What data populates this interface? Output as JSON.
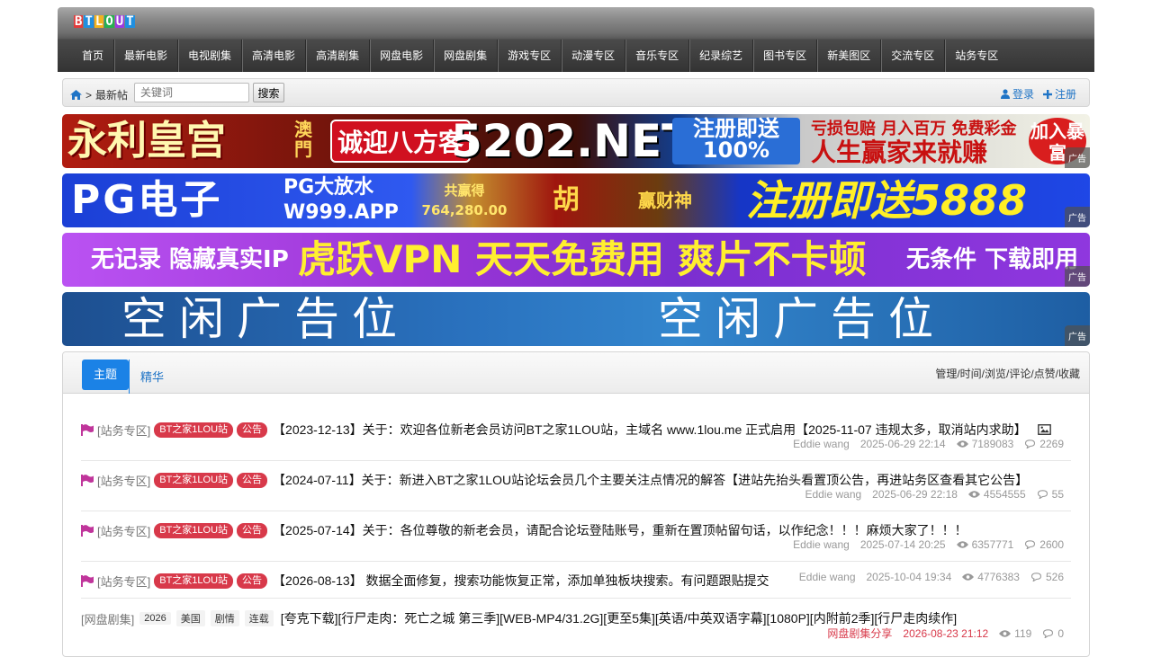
{
  "logo": {
    "letters": [
      "B",
      "T",
      "L",
      "O",
      "U",
      "T"
    ]
  },
  "nav": [
    "首页",
    "最新电影",
    "电视剧集",
    "高清电影",
    "高清剧集",
    "网盘电影",
    "网盘剧集",
    "游戏专区",
    "动漫专区",
    "音乐专区",
    "纪录综艺",
    "图书专区",
    "新美图区",
    "交流专区",
    "站务专区"
  ],
  "breadcrumb": {
    "separator": ">",
    "current": "最新帖"
  },
  "search": {
    "placeholder": "关键词",
    "button": "搜索"
  },
  "auth": {
    "login": "登录",
    "register": "注册"
  },
  "ads": {
    "tag": "广告",
    "ad1": {
      "name": "永利皇宫",
      "badge": "诚迎八方客",
      "domain": "5202.NET",
      "promo_top": "注册即送",
      "promo_bottom": "100%",
      "slogan_top": "亏损包赔 月入百万 免费彩金",
      "slogan_bottom": "人生赢家来就赚",
      "button": "加入暴富",
      "side": "澳門"
    },
    "ad2": {
      "brand": "PG电子",
      "promo": "PG大放水",
      "domain": "W999.APP",
      "jackpot_label": "共赢得",
      "jackpot_value": "764,280.00",
      "char": "胡",
      "slot": "赢财神",
      "offer": "注册即送5888"
    },
    "ad3": {
      "left": "无记录 隐藏真实IP",
      "center": "虎跃VPN 天天免费用 爽片不卡顿",
      "right": "无条件 下载即用"
    },
    "ad4": {
      "left": "空闲广告位",
      "right": "空闲广告位"
    }
  },
  "tabs": {
    "active": "主题",
    "other": "精华",
    "sort_links": "管理/时间/浏览/评论/点赞/收藏"
  },
  "threads": [
    {
      "category": "[站务专区]",
      "badges": [
        "BT之家1LOU站",
        "公告"
      ],
      "title": "【2023-12-13】关于：欢迎各位新老会员访问BT之家1LOU站，主域名 www.1lou.me 正式启用【2025-11-07 违规太多，取消站内求助】",
      "author": "Eddie wang",
      "time": "2025-06-29 22:14",
      "views": "7189083",
      "comments": "2269",
      "has_image": true
    },
    {
      "category": "[站务专区]",
      "badges": [
        "BT之家1LOU站",
        "公告"
      ],
      "title": "【2024-07-11】关于：新进入BT之家1LOU站论坛会员几个主要关注点情况的解答【进站先抬头看置顶公告，再进站务区查看其它公告】",
      "author": "Eddie wang",
      "time": "2025-06-29 22:18",
      "views": "4554555",
      "comments": "55"
    },
    {
      "category": "[站务专区]",
      "badges": [
        "BT之家1LOU站",
        "公告"
      ],
      "title": "【2025-07-14】关于：各位尊敬的新老会员，请配合论坛登陆账号，重新在置顶帖留句话，以作纪念！！！麻烦大家了！！！",
      "author": "Eddie wang",
      "time": "2025-07-14 20:25",
      "views": "6357771",
      "comments": "2600"
    },
    {
      "category": "[站务专区]",
      "badges": [
        "BT之家1LOU站",
        "公告"
      ],
      "title": "【2026-08-13】 数据全面修复，搜索功能恢复正常，添加单独板块搜索。有问题跟贴提交",
      "author": "Eddie wang",
      "time": "2025-10-04 19:34",
      "views": "4776383",
      "comments": "526"
    },
    {
      "category": "[网盘剧集]",
      "tags": [
        "2026",
        "美国",
        "剧情",
        "连载"
      ],
      "title": "[夸克下载][行尸走肉：死亡之城 第三季][WEB-MP4/31.2G][更至5集][英语/中英双语字幕][1080P][内附前2季][行尸走肉续作]",
      "author": "网盘剧集分享",
      "time": "2026-08-23 21:12",
      "views": "119",
      "comments": "0"
    }
  ]
}
